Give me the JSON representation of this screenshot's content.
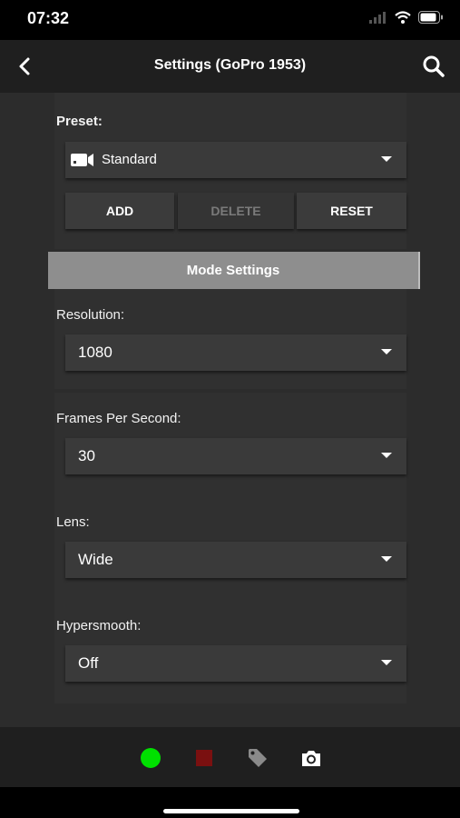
{
  "status_bar": {
    "time": "07:32",
    "icons": [
      "signal-icon",
      "wifi-icon",
      "battery-icon"
    ]
  },
  "nav": {
    "title": "Settings (GoPro 1953)",
    "back_icon": "chevron-left-icon",
    "search_icon": "search-icon"
  },
  "preset": {
    "label": "Preset:",
    "value": "Standard",
    "icon": "video-camera-icon",
    "buttons": {
      "add": "ADD",
      "delete": "DELETE",
      "reset": "RESET"
    }
  },
  "mode_settings": {
    "label": "Mode Settings"
  },
  "settings": [
    {
      "label": "Resolution:",
      "value": "1080"
    },
    {
      "label": "Frames Per Second:",
      "value": "30"
    },
    {
      "label": "Lens:",
      "value": "Wide"
    },
    {
      "label": "Hypersmooth:",
      "value": "Off"
    }
  ],
  "bottom_bar": {
    "icons": [
      "record-icon",
      "stop-icon",
      "tag-icon",
      "camera-icon"
    ]
  },
  "colors": {
    "record": "#00e000",
    "stop": "#7a1010",
    "mode_bar": "#8e8e8e"
  }
}
